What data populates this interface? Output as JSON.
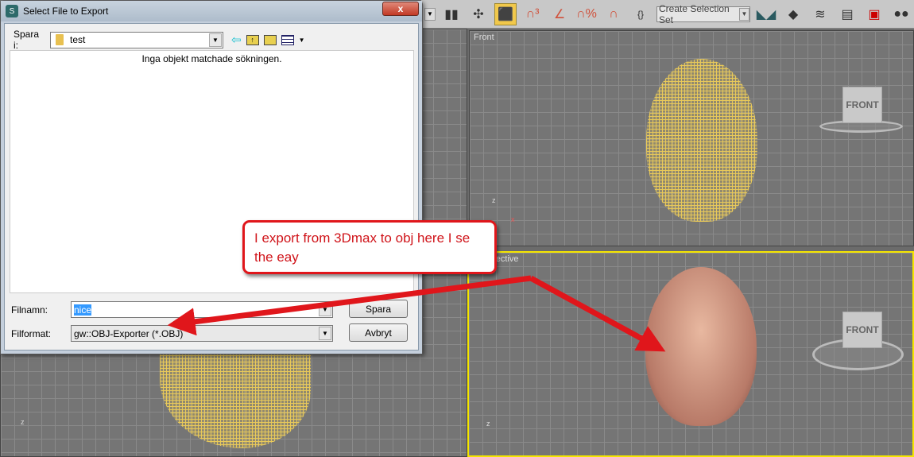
{
  "toolbar": {
    "selection_set": "Create Selection Set",
    "icons": [
      "dropdown-icon",
      "render-toggle-icon",
      "hierarchy-icon",
      "select-object-icon",
      "snap-3d-icon",
      "angle-snap-icon",
      "percent-snap-icon",
      "spinner-snap-icon",
      "named-selection-icon",
      "mirror-icon",
      "align-icon",
      "layers-icon",
      "curve-editor-icon",
      "schematic-icon",
      "material-editor-icon"
    ]
  },
  "viewports": {
    "front": {
      "label": "Front",
      "cube": "FRONT"
    },
    "perspective": {
      "label": "Perspective",
      "cube": "FRONT"
    },
    "axes": {
      "z": "z",
      "x": "x"
    }
  },
  "dialog": {
    "title": "Select File to Export",
    "close": "x",
    "save_in_label": "Spara i:",
    "save_in_value": "test",
    "empty_message": "Inga objekt matchade sökningen.",
    "filename_label": "Filnamn:",
    "filename_value": "nice",
    "format_label": "Filformat:",
    "format_value": "gw::OBJ-Exporter (*.OBJ)",
    "save_button": "Spara",
    "cancel_button": "Avbryt"
  },
  "callout": {
    "text": "I export from 3Dmax to obj here I se the eay"
  },
  "colors": {
    "annotation": "#e0161b",
    "wireframe": "#e8c95a",
    "active_viewport": "#f5e600"
  }
}
